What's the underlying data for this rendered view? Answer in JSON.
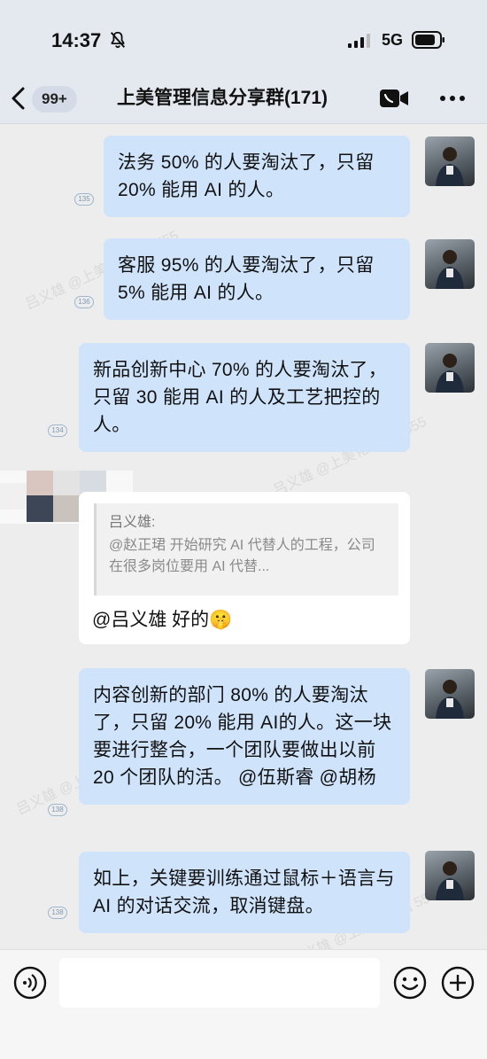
{
  "status": {
    "time": "14:37",
    "network": "5G"
  },
  "header": {
    "unread_badge": "99+",
    "title": "上美管理信息分享群(171)"
  },
  "messages": [
    {
      "text": "法务 50% 的人要淘汰了，只留 20% 能用 AI 的人。",
      "read_count": "135"
    },
    {
      "text": "客服 95% 的人要淘汰了，只留 5% 能用 AI 的人。",
      "read_count": "136"
    },
    {
      "text": "新品创新中心 70% 的人要淘汰了，只留 30 能用 AI 的人及工艺把控的人。",
      "read_count": "134"
    },
    {
      "text": "内容创新的部门 80% 的人要淘汰了，只留 20% 能用 AI的人。这一块要进行整合，一个团队要做出以前 20 个团队的活。 @伍斯睿 @胡杨",
      "read_count": "138"
    },
    {
      "text": "如上，关键要训练通过鼠标＋语言与 AI 的对话交流，取消键盘。",
      "read_count": "138"
    }
  ],
  "reply": {
    "quote_name": "吕义雄:",
    "quote_text": "@赵正珺 开始研究 AI 代替人的工程，公司在很多岗位要用 AI 代替...",
    "text": "@吕义雄 好的🤫"
  },
  "watermark": "吕义雄 @上美化妆品 5555",
  "input": {
    "placeholder": ""
  },
  "colors": {
    "bubble_blue": "#cfe3fb",
    "background": "#ededed",
    "header": "#e4e8ef"
  },
  "icons": [
    "bell-mute-icon",
    "signal-icon",
    "battery-icon",
    "back-icon",
    "video-call-icon",
    "more-icon",
    "voice-icon",
    "emoji-icon",
    "plus-icon"
  ]
}
